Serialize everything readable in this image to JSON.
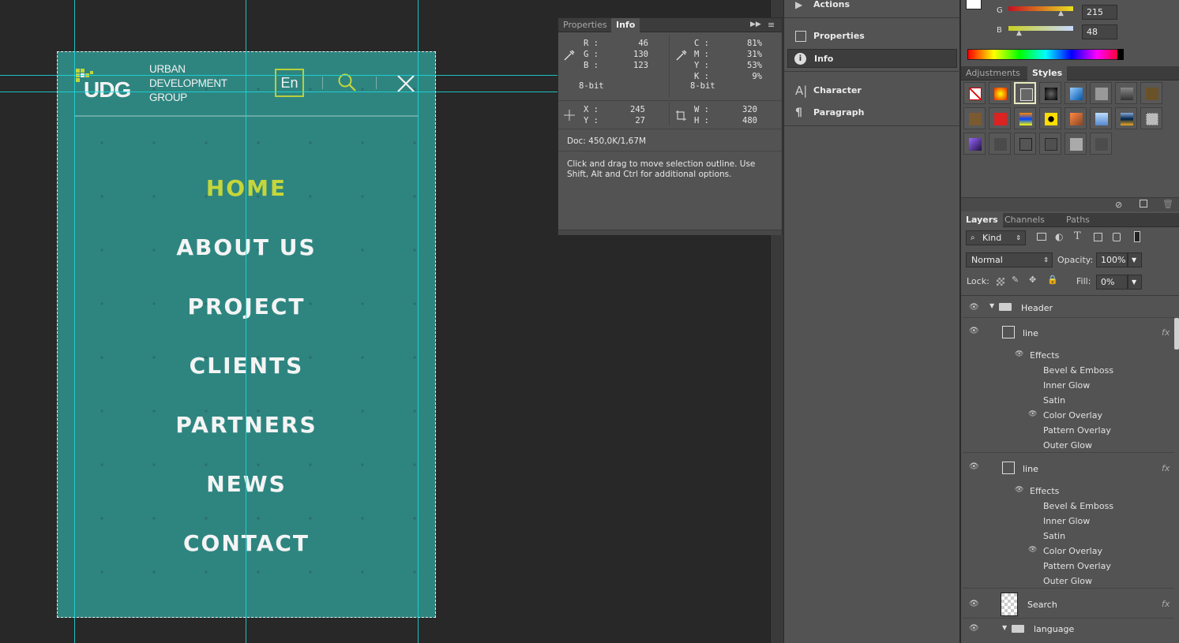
{
  "canvas": {
    "logo": {
      "mark": "UDG",
      "line1": "URBAN",
      "line2": "DEVELOPMENT",
      "line3": "GROUP"
    },
    "lang_button": "En",
    "nav": [
      "HOME",
      "ABOUT US",
      "PROJECT",
      "CLIENTS",
      "PARTNERS",
      "NEWS",
      "CONTACT"
    ],
    "active_nav": "HOME",
    "colors": {
      "background": "#2e8580",
      "accent": "#c4d63a",
      "guide": "#1bd9dd"
    }
  },
  "info_panel": {
    "tabs": [
      "Properties",
      "Info"
    ],
    "active_tab": "Info",
    "rgb": {
      "r_label": "R :",
      "r": "46",
      "g_label": "G :",
      "g": "130",
      "b_label": "B :",
      "b": "123",
      "depth": "8-bit"
    },
    "cmyk": {
      "c_label": "C :",
      "c": "81%",
      "m_label": "M :",
      "m": "31%",
      "y_label": "Y :",
      "y": "53%",
      "k_label": "K :",
      "k": "9%",
      "depth": "8-bit"
    },
    "pos": {
      "x_label": "X :",
      "x": "245",
      "y_label": "Y :",
      "y": "27"
    },
    "size": {
      "w_label": "W :",
      "w": "320",
      "h_label": "H :",
      "h": "480"
    },
    "doc": "Doc: 450,0K/1,67M",
    "hint": "Click and drag to move selection outline.  Use Shift, Alt and Ctrl for additional options."
  },
  "mid_panel": {
    "items": [
      "Actions",
      "Properties",
      "Info",
      "Character",
      "Paragraph"
    ]
  },
  "color_panel": {
    "g_label": "G",
    "g_value": "215",
    "b_label": "B",
    "b_value": "48"
  },
  "styles_panel": {
    "tabs": [
      "Adjustments",
      "Styles"
    ],
    "active_tab": "Styles"
  },
  "layers_panel": {
    "tabs": [
      "Layers",
      "Channels",
      "Paths"
    ],
    "active_tab": "Layers",
    "filter": "Kind",
    "blend_mode": "Normal",
    "opacity_label": "Opacity:",
    "opacity": "100%",
    "lock_label": "Lock:",
    "fill_label": "Fill:",
    "fill": "0%",
    "layers": [
      {
        "name": "Header",
        "type": "group"
      },
      {
        "name": "line",
        "type": "shape",
        "fx": "fx",
        "effects_label": "Effects",
        "effects": [
          "Bevel & Emboss",
          "Inner Glow",
          "Satin",
          "Color Overlay",
          "Pattern Overlay",
          "Outer Glow"
        ]
      },
      {
        "name": "line",
        "type": "shape",
        "fx": "fx",
        "effects_label": "Effects",
        "effects": [
          "Bevel & Emboss",
          "Inner Glow",
          "Satin",
          "Color Overlay",
          "Pattern Overlay",
          "Outer Glow"
        ]
      },
      {
        "name": "Search",
        "type": "smart",
        "fx": "fx"
      },
      {
        "name": "language",
        "type": "group"
      }
    ]
  }
}
